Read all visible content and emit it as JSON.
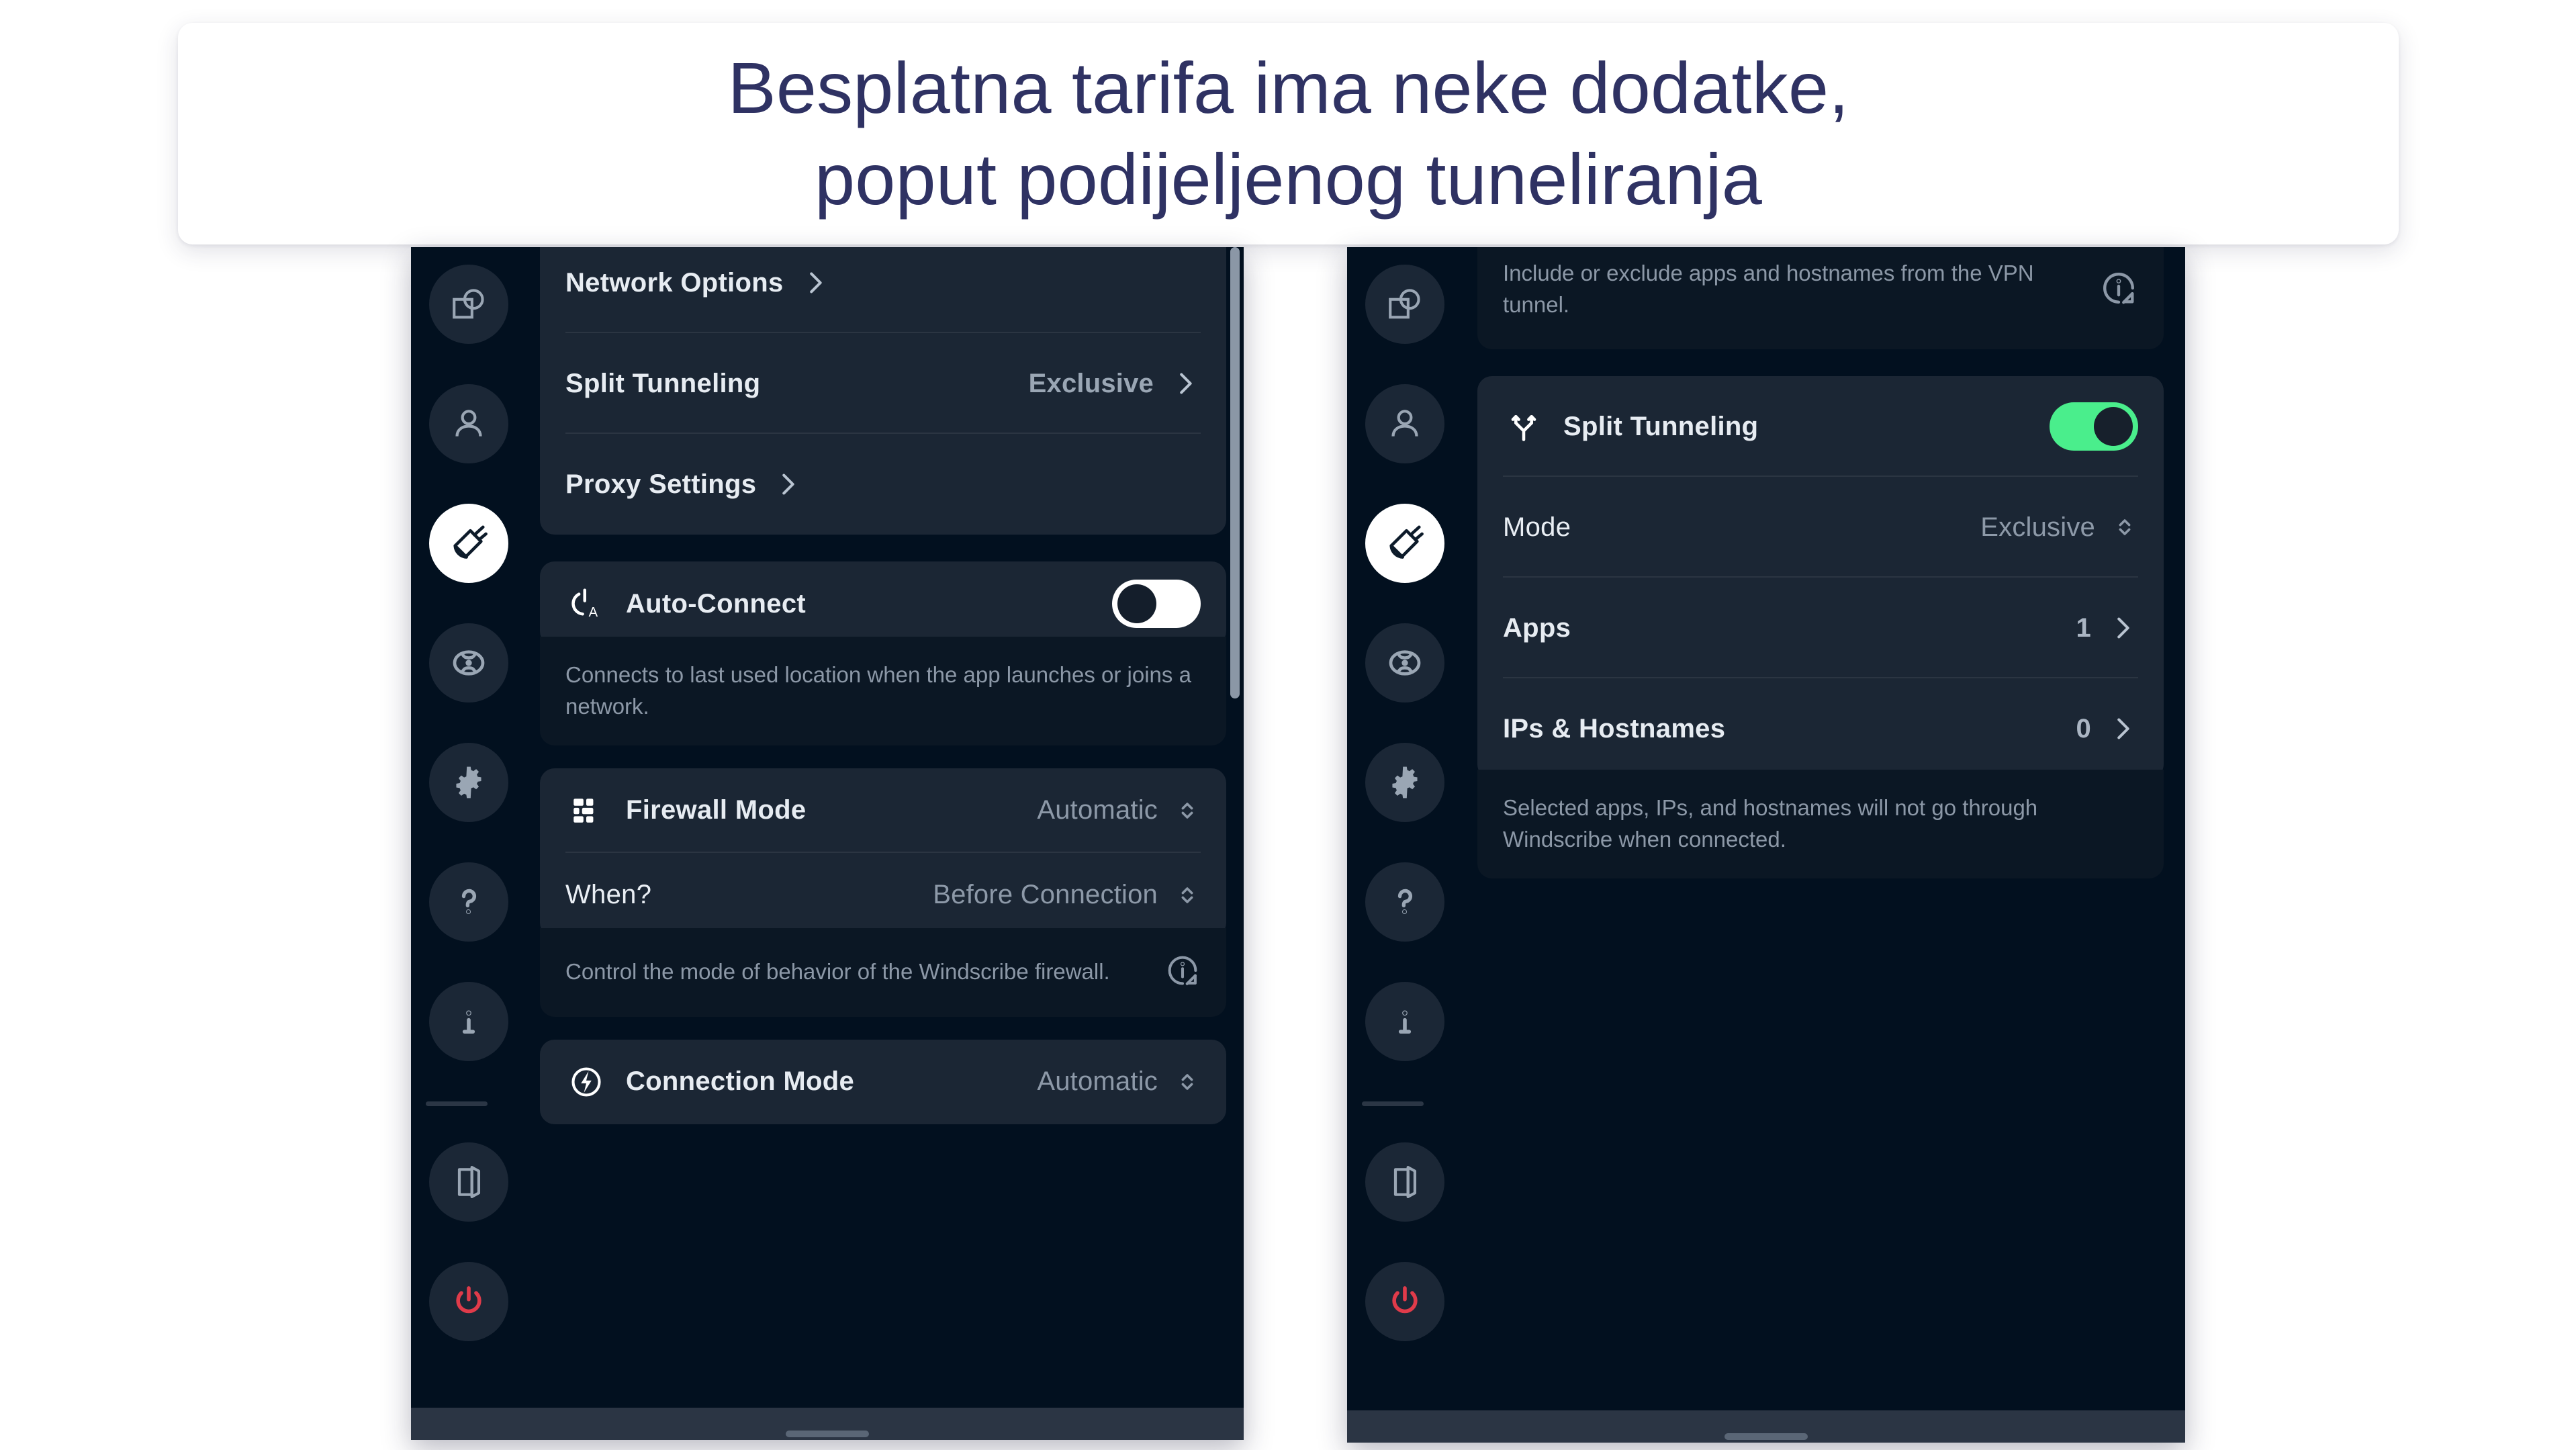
{
  "heading": {
    "text": "Besplatna tarifa ima neke dodatke,\npoput podijeljenog tuneliranja"
  },
  "colors": {
    "page_background": "#ffffff",
    "heading_text": "#2f3263",
    "app_background": "#02101f",
    "card_background": "#1b2634",
    "sub_card_background": "#0b1724",
    "accent_green": "#4aee8c",
    "power_red": "#e03b4a",
    "muted_text": "#8d99a8",
    "primary_text": "#e7ecf2"
  },
  "sidebar": {
    "items": [
      {
        "icon": "general-overlap-icon",
        "name": "sidebar-item-general",
        "active": false
      },
      {
        "icon": "account-person-icon",
        "name": "sidebar-item-account",
        "active": false
      },
      {
        "icon": "connection-dish-icon",
        "name": "sidebar-item-connection",
        "active": true
      },
      {
        "icon": "robot-icon",
        "name": "sidebar-item-robert",
        "active": false
      },
      {
        "icon": "gear-icon",
        "name": "sidebar-item-preferences",
        "active": false
      },
      {
        "icon": "question-mark-icon",
        "name": "sidebar-item-help",
        "active": false
      },
      {
        "icon": "info-icon",
        "name": "sidebar-item-about",
        "active": false
      }
    ],
    "bottom_items": [
      {
        "icon": "exit-door-icon",
        "name": "sidebar-item-logout"
      },
      {
        "icon": "power-icon",
        "name": "sidebar-item-quit"
      }
    ]
  },
  "left_panel": {
    "nav_rows": [
      {
        "label": "Network Options",
        "value": "",
        "chevron": "chevron-right-icon"
      },
      {
        "label": "Split Tunneling",
        "value": "Exclusive",
        "chevron": "chevron-right-icon"
      },
      {
        "label": "Proxy Settings",
        "value": "",
        "chevron": "chevron-right-icon"
      }
    ],
    "auto_connect": {
      "icon": "power-auto-icon",
      "label": "Auto-Connect",
      "toggle_state": "off",
      "description": "Connects to last used location when the app launches or joins a network."
    },
    "firewall": {
      "icon": "firewall-blocks-icon",
      "label": "Firewall Mode",
      "value": "Automatic",
      "when_label": "When?",
      "when_value": "Before Connection",
      "description": "Control the mode of behavior of the Windscribe firewall.",
      "info_icon": "info-external-icon"
    },
    "connection_mode": {
      "icon": "lightning-bolt-icon",
      "label": "Connection Mode",
      "value": "Automatic"
    },
    "scrollbar_visible": true
  },
  "right_panel": {
    "top_description": {
      "text": "Include or exclude apps and hostnames from the VPN tunnel.",
      "info_icon": "info-external-icon"
    },
    "split_tunneling": {
      "icon": "split-tunnel-fork-icon",
      "label": "Split Tunneling",
      "toggle_state": "on",
      "rows": [
        {
          "label": "Mode",
          "value": "Exclusive",
          "control": "updown-stepper-icon"
        },
        {
          "label": "Apps",
          "value": "1",
          "control": "chevron-right-icon"
        },
        {
          "label": "IPs & Hostnames",
          "value": "0",
          "control": "chevron-right-icon"
        }
      ],
      "description": "Selected apps, IPs, and hostnames will not go through Windscribe when connected."
    }
  }
}
